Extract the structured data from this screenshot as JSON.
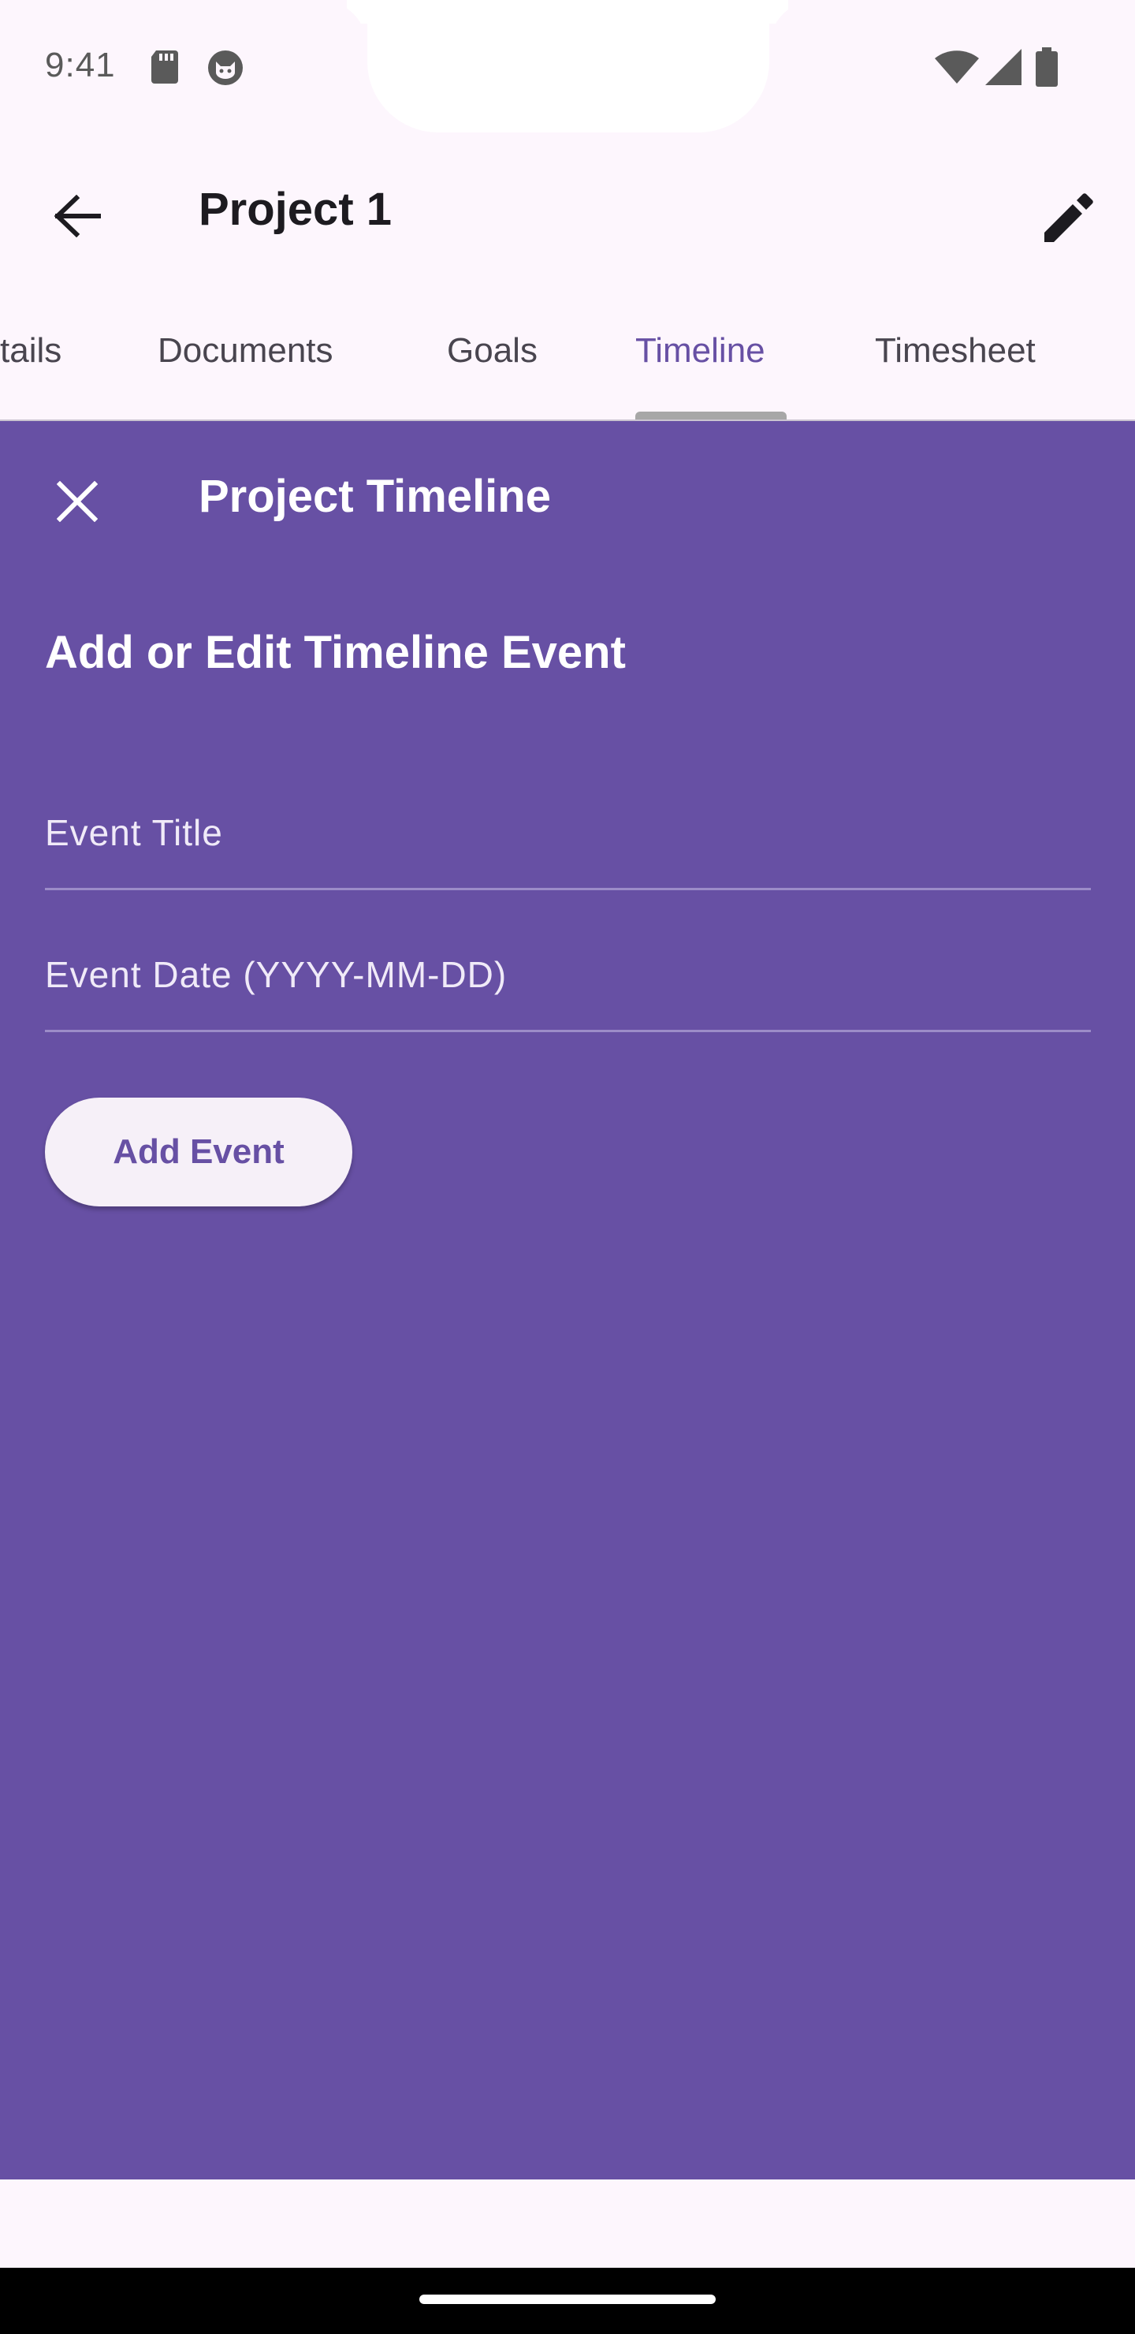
{
  "status_bar": {
    "time": "9:41",
    "icons_left": [
      "sd-card-icon",
      "cat-face-icon"
    ],
    "icons_right": [
      "wifi-icon",
      "cellular-signal-icon",
      "battery-icon"
    ]
  },
  "app_bar": {
    "title": "Project 1",
    "back_icon": "arrow-back-icon",
    "edit_icon": "edit-pencil-icon"
  },
  "tabs": {
    "items": [
      {
        "label": "tails"
      },
      {
        "label": "Documents"
      },
      {
        "label": "Goals"
      },
      {
        "label": "Timeline"
      },
      {
        "label": "Timesheet"
      }
    ],
    "active": "Timeline"
  },
  "sheet": {
    "title": "Project Timeline",
    "close_icon": "close-icon",
    "heading": "Add or Edit Timeline Event",
    "event_title": {
      "value": "",
      "placeholder": "Event Title"
    },
    "event_date": {
      "value": "",
      "placeholder": "Event Date (YYYY-MM-DD)"
    },
    "add_button_label": "Add Event"
  },
  "colors": {
    "primary": "#6750a4",
    "surface": "#fdf6fd",
    "on_primary": "#ffffff",
    "button_bg": "#f6f0f8"
  }
}
